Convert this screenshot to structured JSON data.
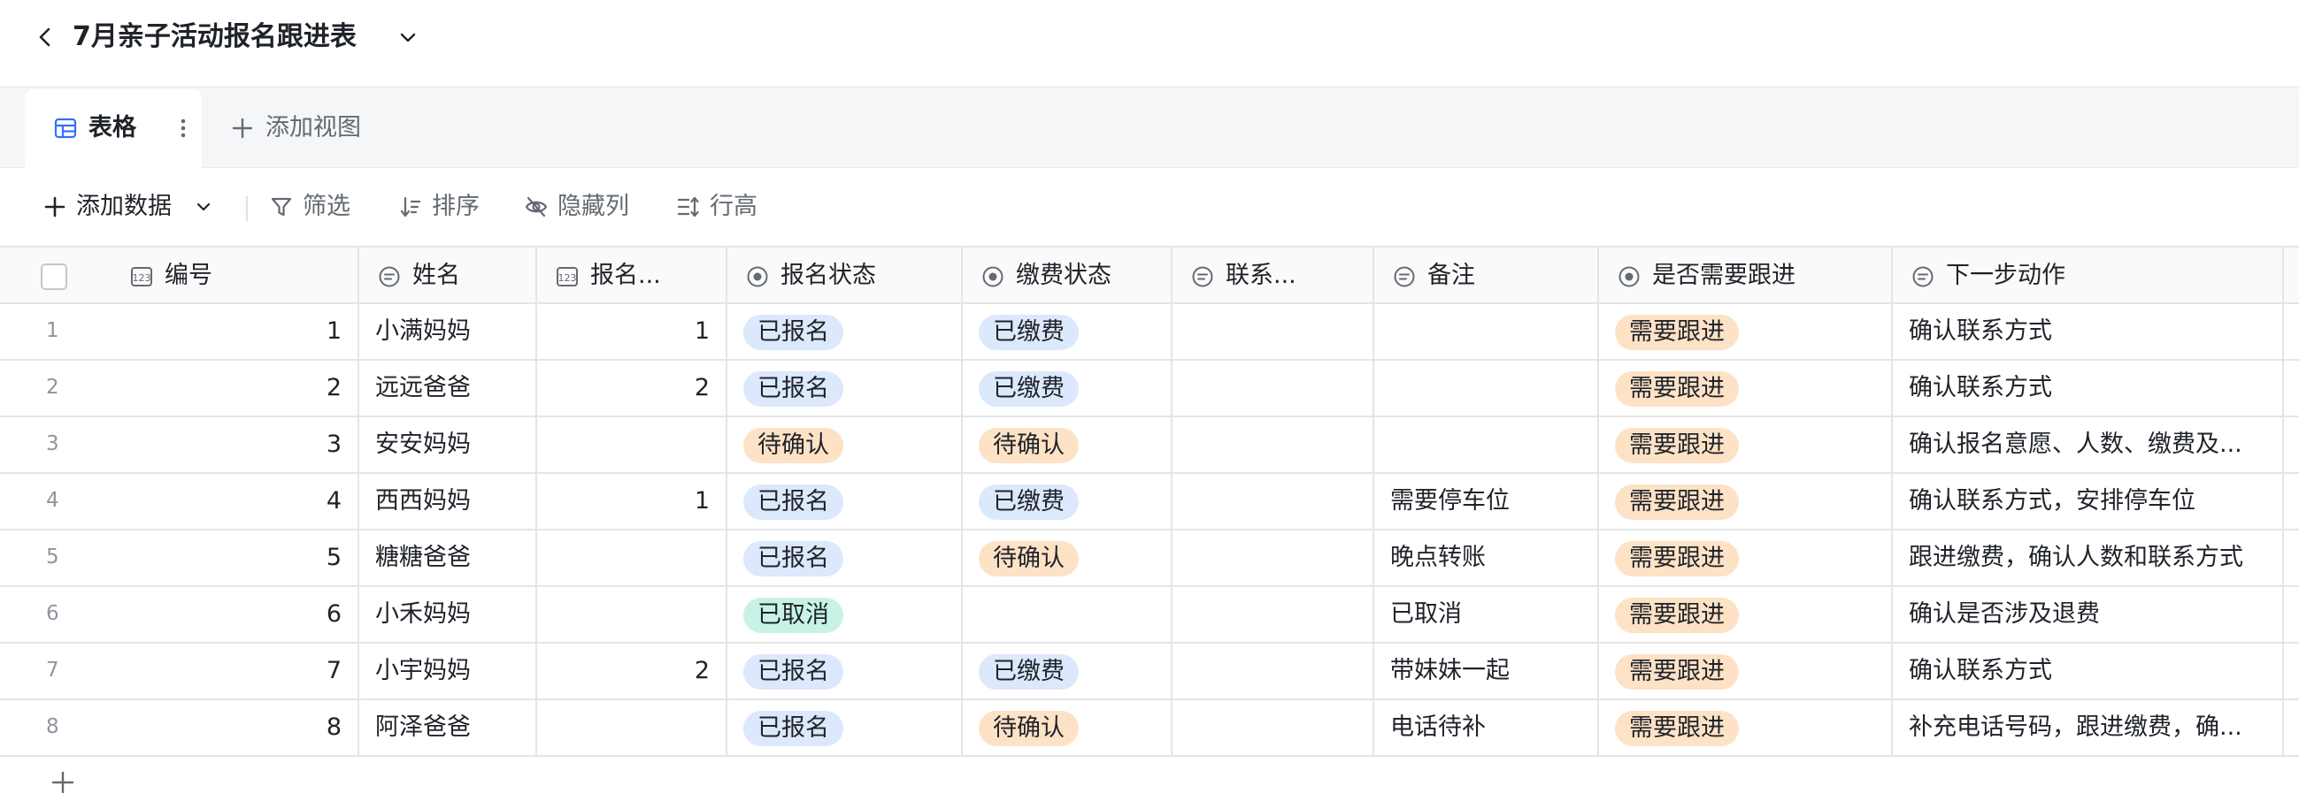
{
  "header": {
    "title": "7月亲子活动报名跟进表",
    "back_icon": "chevron-left-icon",
    "caret_icon": "chevron-down-icon"
  },
  "tabs": {
    "active_label": "表格",
    "add_view_label": "添加视图"
  },
  "toolbar": {
    "add_data": "添加数据",
    "filter": "筛选",
    "sort": "排序",
    "hide_columns": "隐藏列",
    "row_height": "行高"
  },
  "columns": [
    {
      "key": "id",
      "label": "编号",
      "icon": "number-field-icon"
    },
    {
      "key": "name",
      "label": "姓名",
      "icon": "text-field-icon"
    },
    {
      "key": "count",
      "label": "报名...",
      "icon": "number-field-icon"
    },
    {
      "key": "reg",
      "label": "报名状态",
      "icon": "single-select-icon"
    },
    {
      "key": "pay",
      "label": "缴费状态",
      "icon": "single-select-icon"
    },
    {
      "key": "contact",
      "label": "联系...",
      "icon": "text-field-icon"
    },
    {
      "key": "note",
      "label": "备注",
      "icon": "text-field-icon"
    },
    {
      "key": "follow",
      "label": "是否需要跟进",
      "icon": "single-select-icon"
    },
    {
      "key": "next",
      "label": "下一步动作",
      "icon": "text-field-icon"
    }
  ],
  "tag_colors": {
    "blue": {
      "bg": "#dce8fb",
      "fg": "#1f2329"
    },
    "orange": {
      "bg": "#fde2c6",
      "fg": "#1f2329"
    },
    "teal": {
      "bg": "#c9f2e7",
      "fg": "#1f2329"
    }
  },
  "rows": [
    {
      "num": "1",
      "id": "1",
      "name": "小满妈妈",
      "count": "1",
      "reg": "已报名",
      "pay": "已缴费",
      "contact": "",
      "note": "",
      "follow": "需要跟进",
      "next": "确认联系方式"
    },
    {
      "num": "2",
      "id": "2",
      "name": "远远爸爸",
      "count": "2",
      "reg": "已报名",
      "pay": "已缴费",
      "contact": "",
      "note": "",
      "follow": "需要跟进",
      "next": "确认联系方式"
    },
    {
      "num": "3",
      "id": "3",
      "name": "安安妈妈",
      "count": "",
      "reg": "待确认",
      "pay": "待确认",
      "contact": "",
      "note": "",
      "follow": "需要跟进",
      "next": "确认报名意愿、人数、缴费及..."
    },
    {
      "num": "4",
      "id": "4",
      "name": "西西妈妈",
      "count": "1",
      "reg": "已报名",
      "pay": "已缴费",
      "contact": "",
      "note": "需要停车位",
      "follow": "需要跟进",
      "next": "确认联系方式，安排停车位"
    },
    {
      "num": "5",
      "id": "5",
      "name": "糖糖爸爸",
      "count": "",
      "reg": "已报名",
      "pay": "待确认",
      "contact": "",
      "note": "晚点转账",
      "follow": "需要跟进",
      "next": "跟进缴费，确认人数和联系方式"
    },
    {
      "num": "6",
      "id": "6",
      "name": "小禾妈妈",
      "count": "",
      "reg": "已取消",
      "pay": "",
      "contact": "",
      "note": "已取消",
      "follow": "需要跟进",
      "next": "确认是否涉及退费"
    },
    {
      "num": "7",
      "id": "7",
      "name": "小宇妈妈",
      "count": "2",
      "reg": "已报名",
      "pay": "已缴费",
      "contact": "",
      "note": "带妹妹一起",
      "follow": "需要跟进",
      "next": "确认联系方式"
    },
    {
      "num": "8",
      "id": "8",
      "name": "阿泽爸爸",
      "count": "",
      "reg": "已报名",
      "pay": "待确认",
      "contact": "",
      "note": "电话待补",
      "follow": "需要跟进",
      "next": "补充电话号码，跟进缴费，确..."
    }
  ],
  "tag_map": {
    "已报名": "blue",
    "已缴费": "blue",
    "待确认": "orange",
    "需要跟进": "orange",
    "已取消": "teal"
  }
}
